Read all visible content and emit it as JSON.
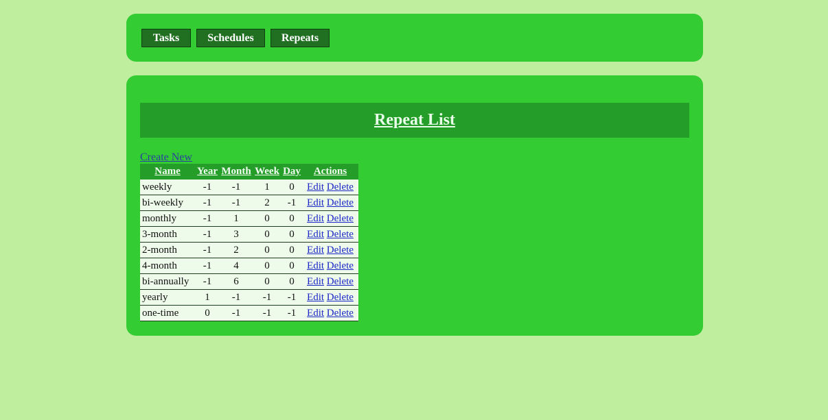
{
  "nav": {
    "tasks": "Tasks",
    "schedules": "Schedules",
    "repeats": "Repeats"
  },
  "main": {
    "title": "Repeat List",
    "create_new": "Create New"
  },
  "table": {
    "headers": {
      "name": "Name",
      "year": "Year",
      "month": "Month",
      "week": "Week",
      "day": "Day",
      "actions": "Actions"
    },
    "edit_label": "Edit",
    "delete_label": "Delete",
    "rows": [
      {
        "name": "weekly",
        "year": "-1",
        "month": "-1",
        "week": "1",
        "day": "0"
      },
      {
        "name": "bi-weekly",
        "year": "-1",
        "month": "-1",
        "week": "2",
        "day": "-1"
      },
      {
        "name": "monthly",
        "year": "-1",
        "month": "1",
        "week": "0",
        "day": "0"
      },
      {
        "name": "3-month",
        "year": "-1",
        "month": "3",
        "week": "0",
        "day": "0"
      },
      {
        "name": "2-month",
        "year": "-1",
        "month": "2",
        "week": "0",
        "day": "0"
      },
      {
        "name": "4-month",
        "year": "-1",
        "month": "4",
        "week": "0",
        "day": "0"
      },
      {
        "name": "bi-annually",
        "year": "-1",
        "month": "6",
        "week": "0",
        "day": "0"
      },
      {
        "name": "yearly",
        "year": "1",
        "month": "-1",
        "week": "-1",
        "day": "-1"
      },
      {
        "name": "one-time",
        "year": "0",
        "month": "-1",
        "week": "-1",
        "day": "-1"
      }
    ]
  },
  "colors": {
    "page_background": "#c0ee9f",
    "panel": "#33cc33",
    "header_bar": "#259e29",
    "nav_button": "#217021",
    "row_background": "#eefaea",
    "link": "#1c27c8"
  }
}
